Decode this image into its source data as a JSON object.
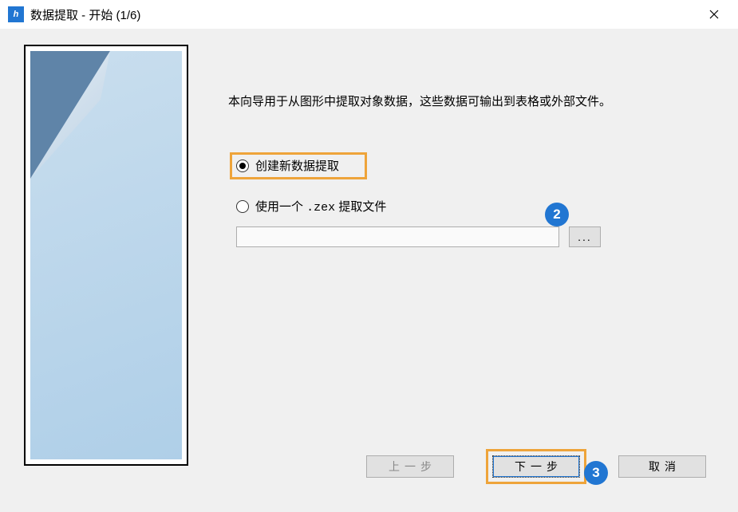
{
  "window": {
    "title": "数据提取 - 开始 (1/6)",
    "app_icon_text": "h"
  },
  "description": "本向导用于从图形中提取对象数据，这些数据可输出到表格或外部文件。",
  "options": {
    "create_new": "创建新数据提取",
    "use_file_prefix": "使用一个 ",
    "use_file_ext": ".zex",
    "use_file_suffix": " 提取文件",
    "file_path": "",
    "browse": "..."
  },
  "buttons": {
    "prev": "上一步",
    "next": "下一步",
    "cancel": "取消"
  },
  "callouts": {
    "c2": "2",
    "c3": "3"
  }
}
